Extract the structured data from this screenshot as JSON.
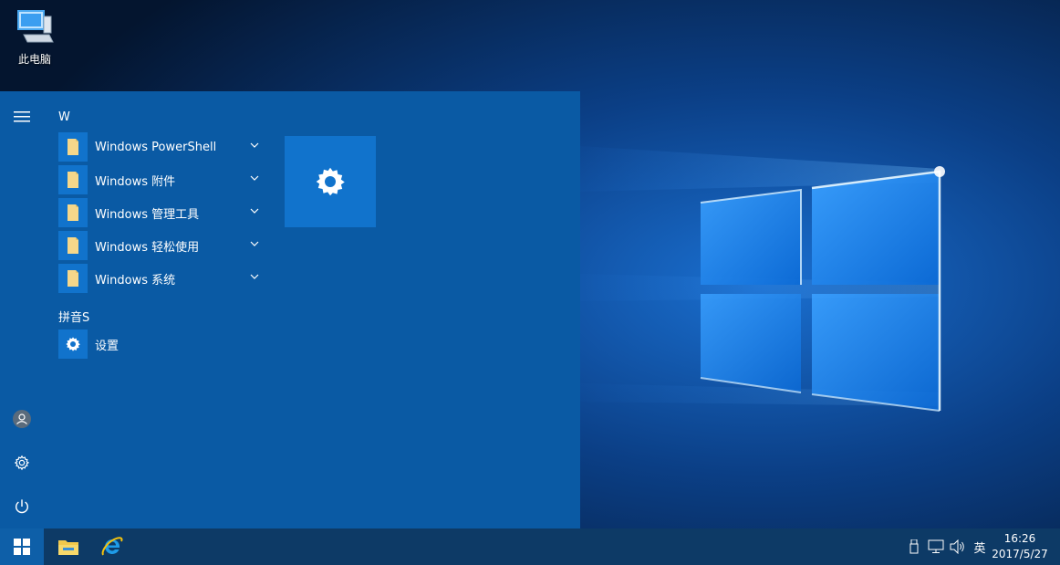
{
  "desktop": {
    "this_pc_label": "此电脑"
  },
  "start_menu": {
    "rail": {
      "menu_icon": "hamburger-icon",
      "user_icon": "user-avatar-icon",
      "settings_icon": "gear-icon",
      "power_icon": "power-icon"
    },
    "groups": [
      {
        "header": "W",
        "items": [
          {
            "label": "Windows PowerShell",
            "icon": "folder-icon",
            "expandable": true
          },
          {
            "label": "Windows 附件",
            "icon": "folder-icon",
            "expandable": true
          },
          {
            "label": "Windows 管理工具",
            "icon": "folder-icon",
            "expandable": true
          },
          {
            "label": "Windows 轻松使用",
            "icon": "folder-icon",
            "expandable": true
          },
          {
            "label": "Windows 系统",
            "icon": "folder-icon",
            "expandable": true
          }
        ]
      },
      {
        "header": "拼音S",
        "items": [
          {
            "label": "设置",
            "icon": "gear-icon",
            "expandable": false
          }
        ]
      }
    ],
    "tiles": [
      {
        "icon": "gear-icon"
      }
    ]
  },
  "taskbar": {
    "start_icon": "windows-logo-icon",
    "pinned": [
      {
        "icon": "file-explorer-icon"
      },
      {
        "icon": "internet-explorer-icon"
      }
    ],
    "tray": {
      "usb_icon": "usb-device-icon",
      "network_icon": "network-icon",
      "volume_icon": "volume-icon",
      "ime_label": "英"
    },
    "clock": {
      "time": "16:26",
      "date": "2017/5/27"
    }
  },
  "colors": {
    "start_menu_bg": "#0a5aa4",
    "tile_bg": "#1173cc",
    "taskbar_bg": "#0d3a66",
    "folder_yellow": "#f5d78a"
  }
}
